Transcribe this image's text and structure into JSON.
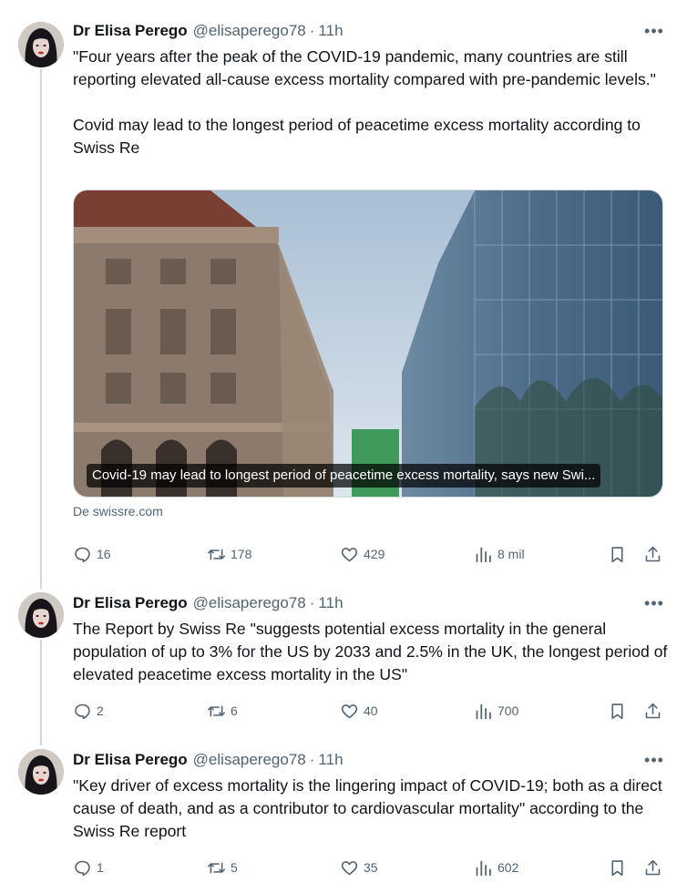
{
  "tweets": [
    {
      "author": "Dr Elisa Perego",
      "handle": "@elisaperego78",
      "separator": "·",
      "time": "11h",
      "text": "\"Four years after the peak of the COVID-19 pandemic, many countries are still reporting elevated all-cause excess mortality compared with pre-pandemic levels.\"\n\nCovid may lead to the longest period of peacetime excess mortality according to Swiss Re",
      "card": {
        "caption": "Covid-19 may lead to longest period of peacetime excess mortality, says new Swi...",
        "source": "De swissre.com"
      },
      "replies": "16",
      "reposts": "178",
      "likes": "429",
      "views": "8 mil"
    },
    {
      "author": "Dr Elisa Perego",
      "handle": "@elisaperego78",
      "separator": "·",
      "time": "11h",
      "text": "The Report by Swiss Re \"suggests potential excess mortality in the general population of up to 3% for the US by 2033 and 2.5% in the UK, the longest period of elevated peacetime excess mortality in the US\"",
      "replies": "2",
      "reposts": "6",
      "likes": "40",
      "views": "700"
    },
    {
      "author": "Dr Elisa Perego",
      "handle": "@elisaperego78",
      "separator": "·",
      "time": "11h",
      "text": "\"Key driver of excess mortality is the lingering impact of COVID-19; both as a direct cause of death, and as a contributor to cardiovascular mortality\" according to the Swiss Re report",
      "replies": "1",
      "reposts": "5",
      "likes": "35",
      "views": "602"
    }
  ],
  "icons": {
    "more": "more-icon",
    "reply": "reply-icon",
    "repost": "repost-icon",
    "like": "like-icon",
    "views": "views-icon",
    "bookmark": "bookmark-icon",
    "share": "share-icon"
  },
  "colors": {
    "text": "#0f1419",
    "muted": "#536471",
    "thread_line": "#cfd9de"
  }
}
